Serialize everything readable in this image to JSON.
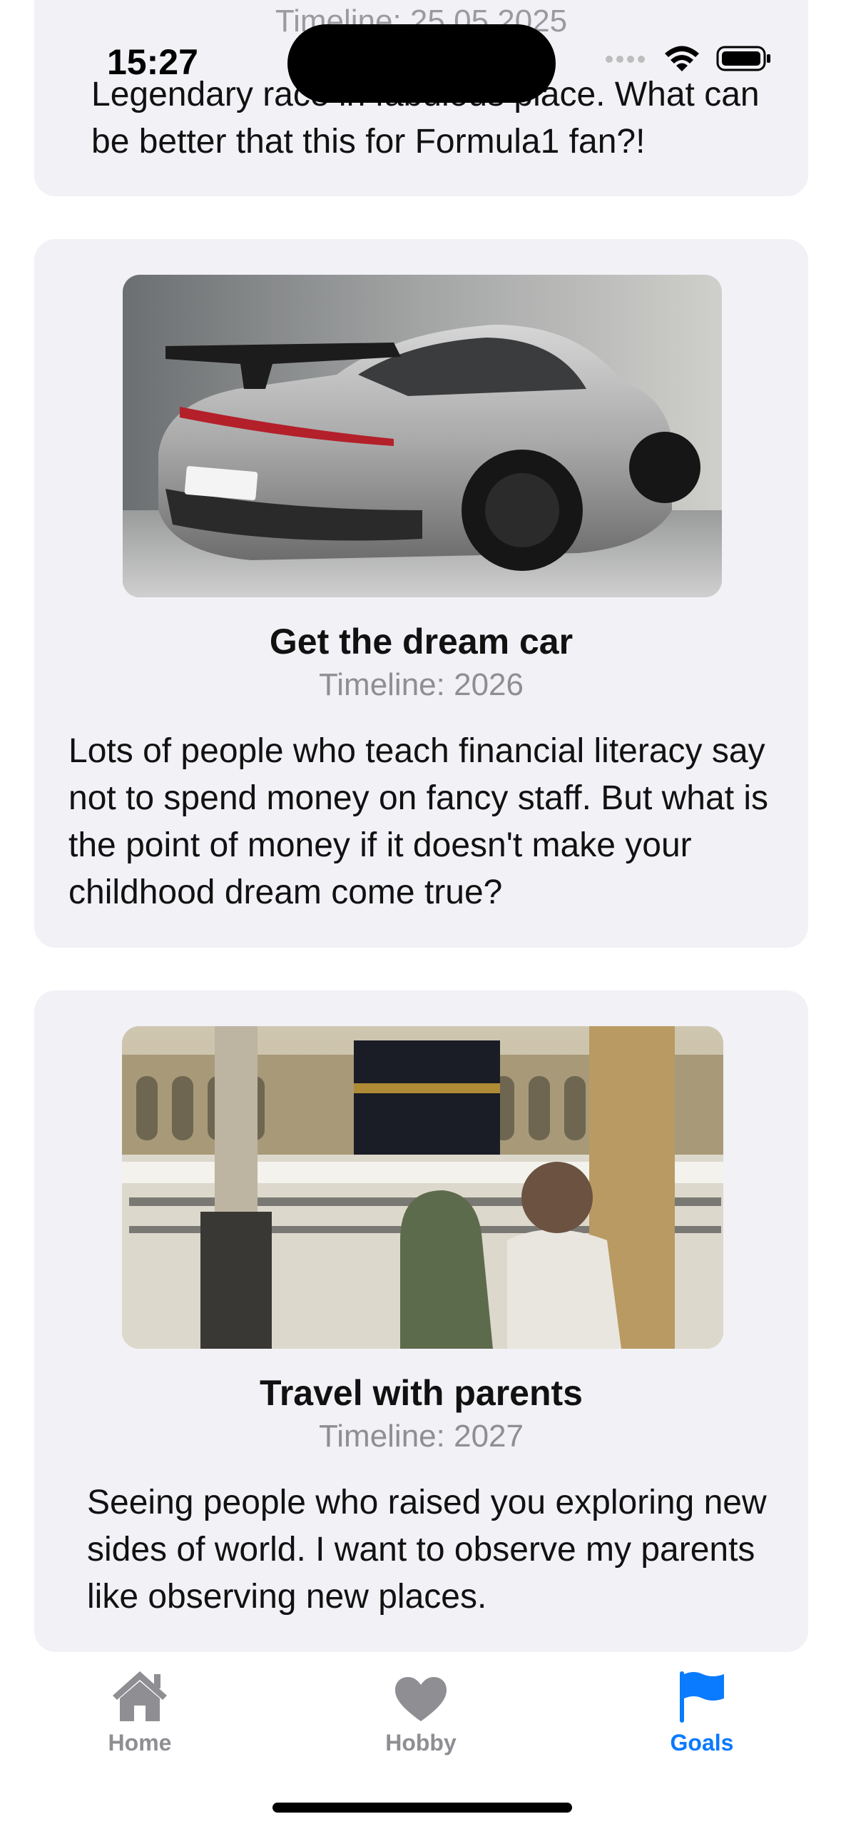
{
  "status_bar": {
    "time": "15:27"
  },
  "cards": [
    {
      "timeline": "Timeline: 25.05.2025",
      "description": "Legendary race in fabulous place. What can be better that this for Formula1 fan?!"
    },
    {
      "title": "Get the dream car",
      "timeline": "Timeline: 2026",
      "description": "Lots of people who teach financial literacy say not to spend money on fancy staff. But what is the point of money if it doesn't make your childhood dream come true?"
    },
    {
      "title": "Travel with parents",
      "timeline": "Timeline: 2027",
      "description": "Seeing people who raised you exploring new sides of world. I want to observe my parents like observing new places."
    }
  ],
  "tabbar": {
    "tabs": [
      {
        "label": "Home",
        "icon": "house-icon",
        "active": false
      },
      {
        "label": "Hobby",
        "icon": "heart-icon",
        "active": false
      },
      {
        "label": "Goals",
        "icon": "flag-icon",
        "active": true
      }
    ],
    "active_color": "#0a7aff",
    "inactive_color": "#8e8e93"
  }
}
